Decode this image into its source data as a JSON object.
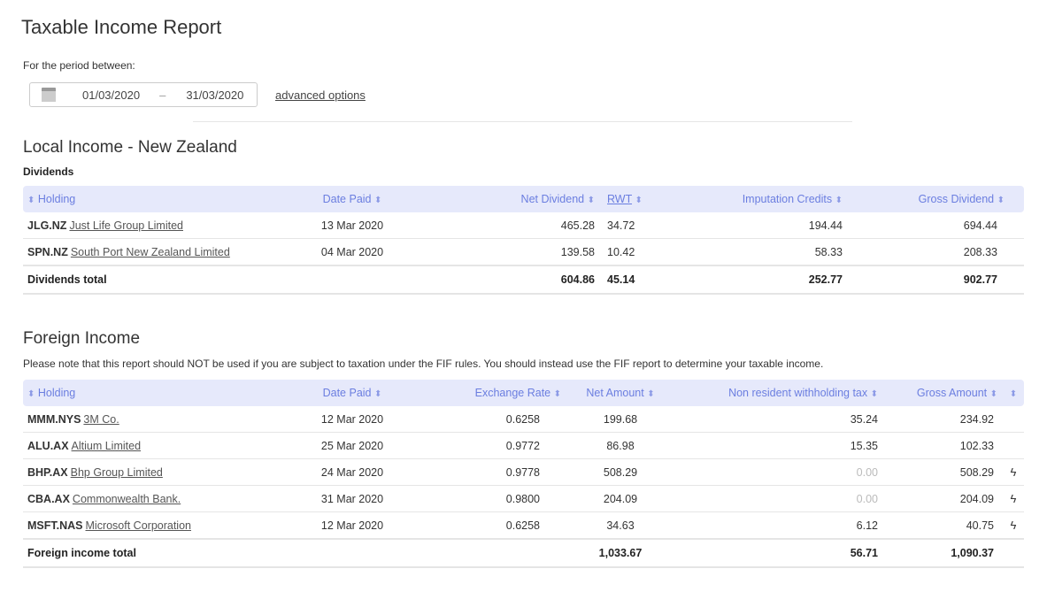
{
  "page": {
    "title": "Taxable Income Report",
    "period_label": "For the period between:",
    "date_from": "01/03/2020",
    "date_separator": "–",
    "date_to": "31/03/2020",
    "advanced_options": "advanced options"
  },
  "local": {
    "heading": "Local Income - New Zealand",
    "subheading": "Dividends",
    "headers": {
      "holding": "Holding",
      "date_paid": "Date Paid",
      "net_dividend": "Net Dividend",
      "rwt": "RWT",
      "imputation": "Imputation Credits",
      "gross": "Gross Dividend"
    },
    "rows": [
      {
        "symbol": "JLG.NZ",
        "name": "Just Life Group Limited",
        "date": "13 Mar 2020",
        "net": "465.28",
        "rwt": "34.72",
        "imputation": "194.44",
        "gross": "694.44"
      },
      {
        "symbol": "SPN.NZ",
        "name": "South Port New Zealand Limited",
        "date": "04 Mar 2020",
        "net": "139.58",
        "rwt": "10.42",
        "imputation": "58.33",
        "gross": "208.33"
      }
    ],
    "total": {
      "label": "Dividends total",
      "net": "604.86",
      "rwt": "45.14",
      "imputation": "252.77",
      "gross": "902.77"
    }
  },
  "foreign": {
    "heading": "Foreign Income",
    "note": "Please note that this report should NOT be used if you are subject to taxation under the FIF rules. You should instead use the FIF report to determine your taxable income.",
    "headers": {
      "holding": "Holding",
      "date_paid": "Date Paid",
      "exchange_rate": "Exchange Rate",
      "net_amount": "Net Amount",
      "nrwt": "Non resident withholding tax",
      "gross": "Gross Amount"
    },
    "rows": [
      {
        "symbol": "MMM.NYS",
        "name": "3M Co.",
        "date": "12 Mar 2020",
        "rate": "0.6258",
        "net": "199.68",
        "nrwt": "35.24",
        "gross": "234.92",
        "bolt": ""
      },
      {
        "symbol": "ALU.AX",
        "name": "Altium Limited",
        "date": "25 Mar 2020",
        "rate": "0.9772",
        "net": "86.98",
        "nrwt": "15.35",
        "gross": "102.33",
        "bolt": ""
      },
      {
        "symbol": "BHP.AX",
        "name": "Bhp Group Limited",
        "date": "24 Mar 2020",
        "rate": "0.9778",
        "net": "508.29",
        "nrwt": "0.00",
        "gross": "508.29",
        "bolt": "ϟ"
      },
      {
        "symbol": "CBA.AX",
        "name": "Commonwealth Bank.",
        "date": "31 Mar 2020",
        "rate": "0.9800",
        "net": "204.09",
        "nrwt": "0.00",
        "gross": "204.09",
        "bolt": "ϟ"
      },
      {
        "symbol": "MSFT.NAS",
        "name": "Microsoft Corporation",
        "date": "12 Mar 2020",
        "rate": "0.6258",
        "net": "34.63",
        "nrwt": "6.12",
        "gross": "40.75",
        "bolt": "ϟ"
      }
    ],
    "total": {
      "label": "Foreign income total",
      "net": "1,033.67",
      "nrwt": "56.71",
      "gross": "1,090.37"
    }
  },
  "icons": {
    "sort": "sort-updown-icon",
    "calendar": "calendar-icon",
    "bolt": "lightning-bolt-icon"
  }
}
